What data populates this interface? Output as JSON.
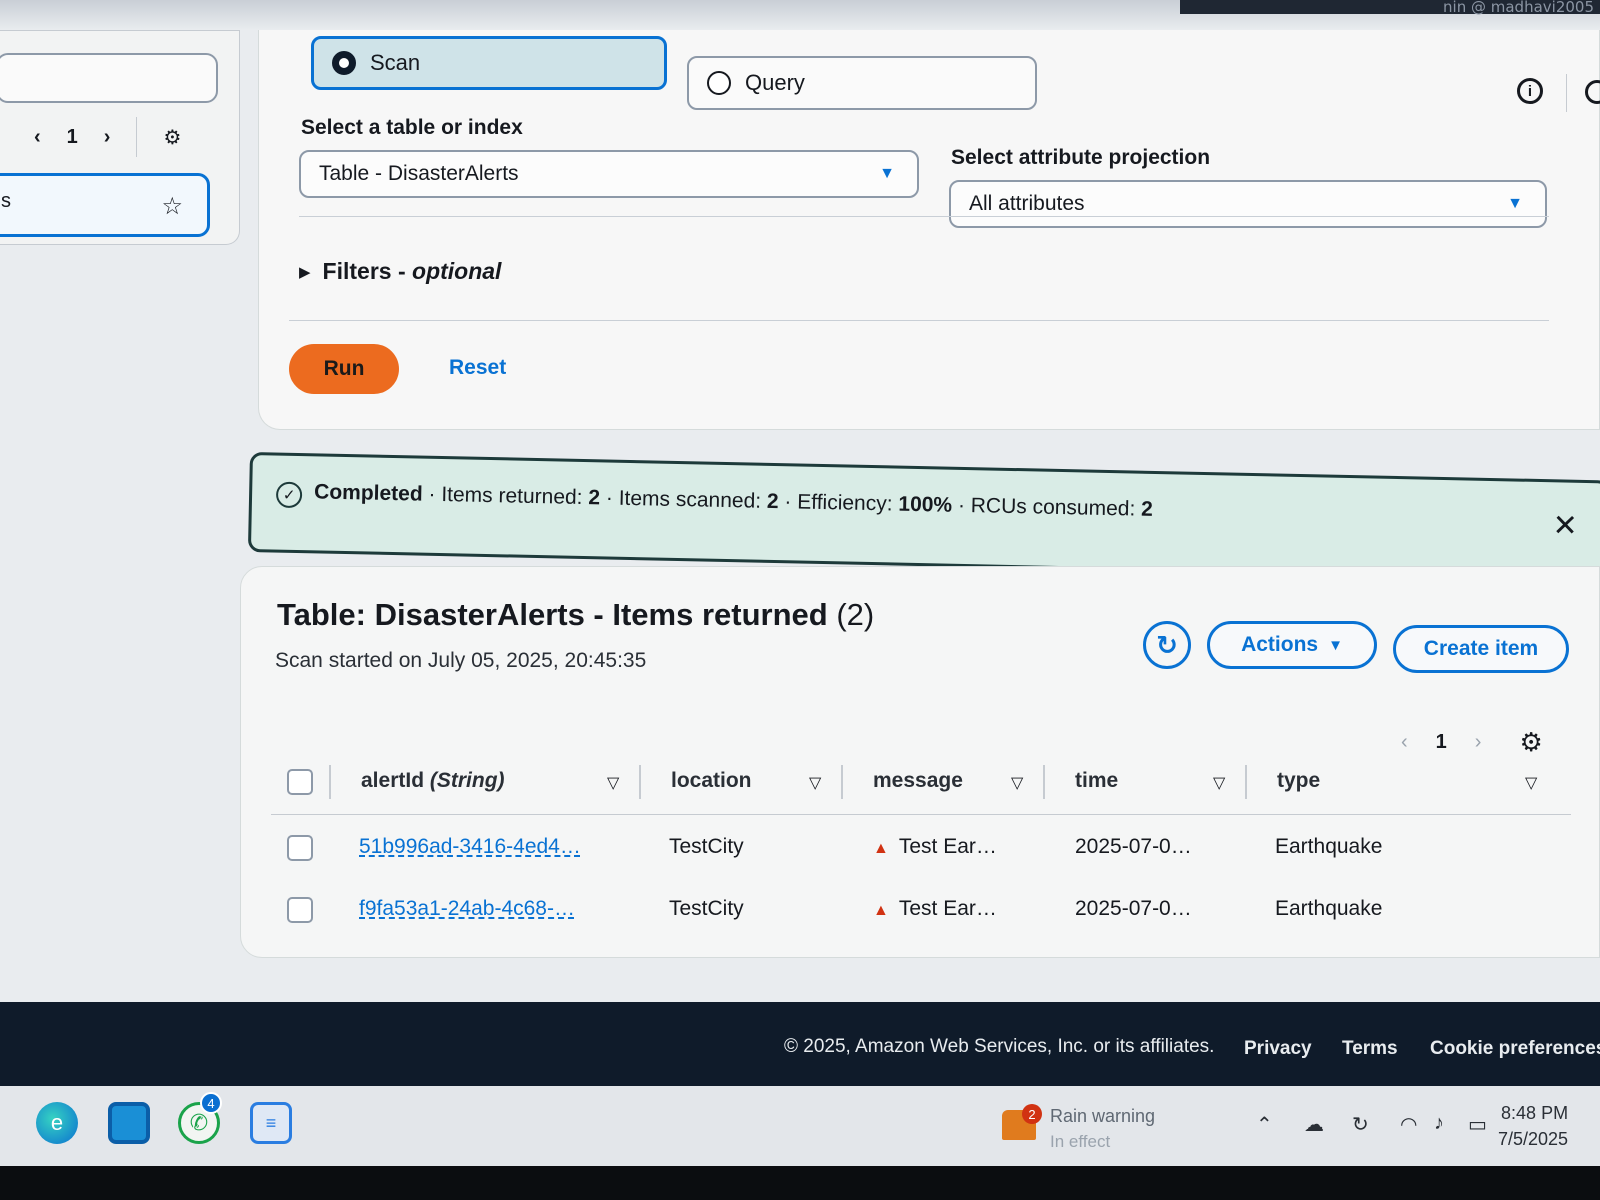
{
  "header": {
    "user_fragment": "nin @ madhavi2005"
  },
  "sidebar": {
    "pager": {
      "prev": "‹",
      "page": "1",
      "next": "›"
    },
    "item_label": "s"
  },
  "query_panel": {
    "modes": [
      {
        "label": "Scan",
        "selected": true
      },
      {
        "label": "Query",
        "selected": false
      }
    ],
    "table_select": {
      "label": "Select a table or index",
      "value": "Table - DisasterAlerts"
    },
    "projection_select": {
      "label": "Select attribute projection",
      "value": "All attributes"
    },
    "filters": {
      "label": "Filters - ",
      "optional": "optional"
    },
    "run_label": "Run",
    "reset_label": "Reset"
  },
  "flash": {
    "status": "Completed",
    "returned_label": " · Items returned: ",
    "returned": "2",
    "scanned_label": " · Items scanned: ",
    "scanned": "2",
    "efficiency_label": " · Efficiency: ",
    "efficiency": "100%",
    "rcu_label": " · RCUs consumed: ",
    "rcu": "2"
  },
  "results": {
    "title": "Table: DisasterAlerts - Items returned",
    "count": "(2)",
    "subtitle": "Scan started on July 05, 2025, 20:45:35",
    "actions_label": "Actions",
    "create_label": "Create item",
    "pager": {
      "prev": "‹",
      "page": "1",
      "next": "›"
    },
    "columns": [
      {
        "name": "alertId",
        "type": "(String)"
      },
      {
        "name": "location"
      },
      {
        "name": "message"
      },
      {
        "name": "time"
      },
      {
        "name": "type"
      }
    ],
    "rows": [
      {
        "alertId": "51b996ad-3416-4ed4…",
        "location": "TestCity",
        "message": "Test Ear…",
        "time": "2025-07-0…",
        "type": "Earthquake"
      },
      {
        "alertId": "f9fa53a1-24ab-4c68-…",
        "location": "TestCity",
        "message": "Test Ear…",
        "time": "2025-07-0…",
        "type": "Earthquake"
      }
    ]
  },
  "footer": {
    "copyright": "© 2025, Amazon Web Services, Inc. or its affiliates.",
    "links": [
      "Privacy",
      "Terms",
      "Cookie preferences"
    ]
  },
  "taskbar": {
    "whatsapp_badge": "4",
    "weather_badge": "2",
    "weather_title": "Rain warning",
    "weather_sub": "In effect",
    "time": "8:48 PM",
    "date": "7/5/2025"
  },
  "colors": {
    "accent": "#0972d3",
    "run": "#ec6b1f",
    "footer": "#0f1b2a",
    "success_bg": "#d9ece6"
  }
}
